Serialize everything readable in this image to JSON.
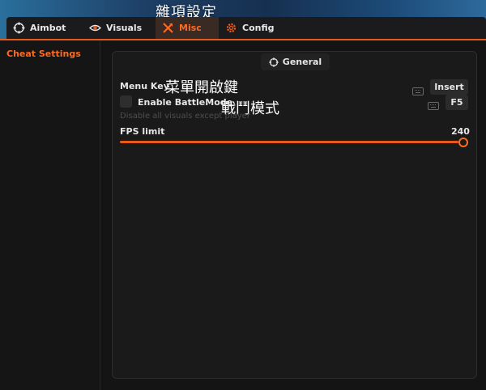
{
  "header": {
    "overlay_title": "雜項設定"
  },
  "tabs": [
    {
      "label": "Aimbot",
      "icon": "crosshair-icon"
    },
    {
      "label": "Visuals",
      "icon": "eye-icon"
    },
    {
      "label": "Misc",
      "icon": "tools-icon",
      "active": true
    },
    {
      "label": "Config",
      "icon": "gear-icon"
    }
  ],
  "sidebar": {
    "items": [
      {
        "label": "Cheat Settings",
        "active": true
      }
    ]
  },
  "panel": {
    "title": "General",
    "menu_key": {
      "label": "Menu Key",
      "cjk": "菜單開啟鍵",
      "key": "Insert"
    },
    "battle_mode": {
      "label": "Enable BattleMode",
      "cjk": "戰鬥模式",
      "key": "F5",
      "checked": false,
      "hint": "Disable all visuals except player"
    },
    "fps_limit": {
      "label": "FPS limit",
      "value": "240",
      "fraction": 1.0
    }
  },
  "colors": {
    "accent": "#ff6a1f",
    "accent_line": "#e85a1a",
    "panel_bg": "#1a1a1a"
  }
}
